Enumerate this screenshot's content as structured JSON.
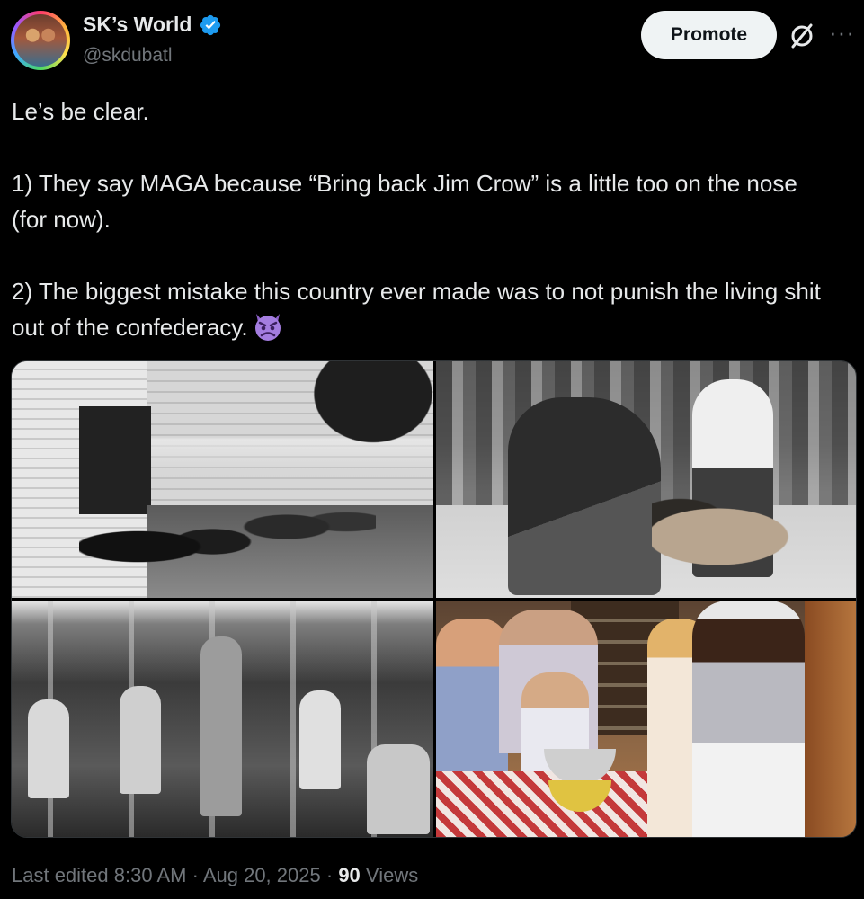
{
  "author": {
    "display_name": "SK’s World",
    "handle": "@skdubatl",
    "verified": true,
    "avatar_icon": "profile-avatar"
  },
  "actions": {
    "promote_label": "Promote",
    "grok_icon": "grok-icon",
    "more_icon": "more-icon"
  },
  "tweet": {
    "line1": "Le’s be clear.",
    "para1": "1) They say MAGA because “Bring back Jim Crow” is a little too on the nose (for now).",
    "para2": "2) The biggest mistake this country ever made was to not punish the living shit out of the confederacy.",
    "emoji": "angry-devil-face"
  },
  "media": {
    "count": 4
  },
  "meta": {
    "edited_label": "Last edited 8:30 AM",
    "separator": "·",
    "date": "Aug 20, 2025",
    "views_count": "90",
    "views_label": "Views"
  },
  "colors": {
    "background": "#000000",
    "text_primary": "#e7e9ea",
    "text_secondary": "#71767b",
    "verified": "#1d9bf0",
    "promote_bg": "#eff3f4"
  }
}
